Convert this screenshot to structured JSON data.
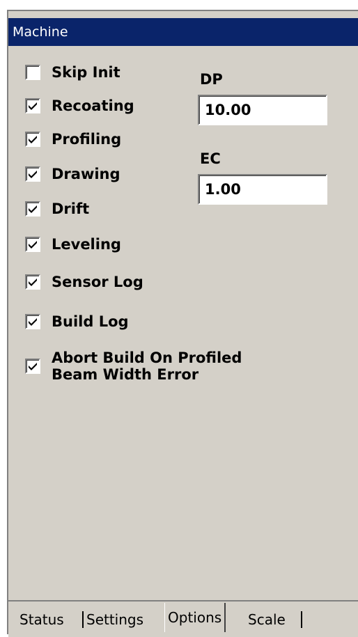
{
  "window": {
    "title": "Machine"
  },
  "checkboxes": [
    {
      "label": "Skip Init",
      "checked": false
    },
    {
      "label": "Recoating",
      "checked": true
    },
    {
      "label": "Profiling",
      "checked": true
    },
    {
      "label": "Drawing",
      "checked": true
    },
    {
      "label": "Drift",
      "checked": true
    },
    {
      "label": "Leveling",
      "checked": true
    },
    {
      "label": "Sensor Log",
      "checked": true
    },
    {
      "label": "Build Log",
      "checked": true
    },
    {
      "label": "Abort Build On Profiled\nBeam Width Error",
      "checked": true
    }
  ],
  "fields": {
    "dp": {
      "label": "DP",
      "value": "10.00"
    },
    "ec": {
      "label": "EC",
      "value": "1.00"
    }
  },
  "tabs": [
    {
      "label": "Status",
      "selected": false
    },
    {
      "label": "Settings",
      "selected": false
    },
    {
      "label": "Options",
      "selected": true
    },
    {
      "label": "Scale",
      "selected": false
    }
  ],
  "colors": {
    "titlebar": "#0a246a",
    "face": "#d4d0c8"
  }
}
